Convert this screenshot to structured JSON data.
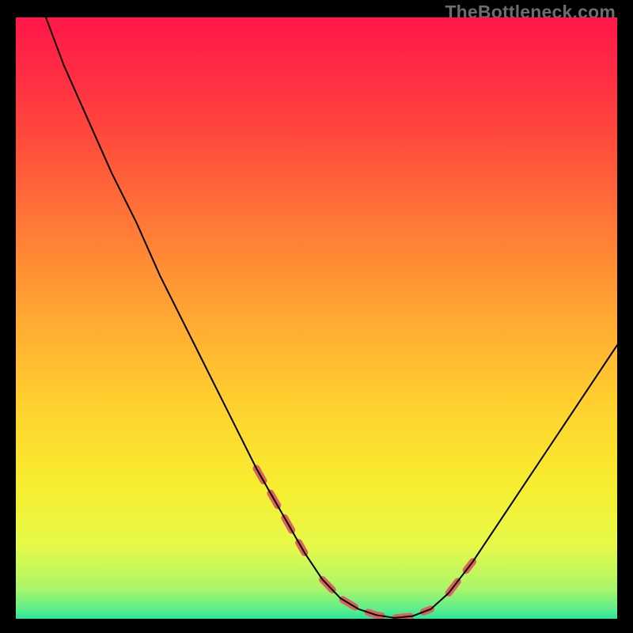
{
  "watermark": "TheBottleneck.com",
  "chart_data": {
    "type": "line",
    "title": "",
    "xlabel": "",
    "ylabel": "",
    "xlim": [
      0,
      100
    ],
    "ylim": [
      0,
      100
    ],
    "background_gradient_stops": [
      {
        "offset": 0.0,
        "color": "#ff1749"
      },
      {
        "offset": 0.08,
        "color": "#ff2945"
      },
      {
        "offset": 0.2,
        "color": "#ff4a3c"
      },
      {
        "offset": 0.35,
        "color": "#ff7a36"
      },
      {
        "offset": 0.5,
        "color": "#ffa932"
      },
      {
        "offset": 0.65,
        "color": "#ffd22e"
      },
      {
        "offset": 0.78,
        "color": "#f7ee2f"
      },
      {
        "offset": 0.88,
        "color": "#e6f94a"
      },
      {
        "offset": 0.95,
        "color": "#a9f668"
      },
      {
        "offset": 0.985,
        "color": "#5bee8c"
      },
      {
        "offset": 1.0,
        "color": "#27e79b"
      }
    ],
    "series": [
      {
        "name": "curve",
        "x": [
          5,
          8,
          12,
          16,
          20,
          24,
          28,
          32,
          36,
          40,
          44,
          48,
          51,
          54,
          57,
          60,
          63,
          66,
          69,
          72,
          76,
          80,
          84,
          88,
          92,
          96,
          100
        ],
        "y": [
          100,
          92,
          83,
          74,
          66,
          57,
          49,
          41,
          33,
          25,
          18,
          11,
          6.5,
          3.4,
          1.6,
          0.6,
          0.15,
          0.45,
          1.6,
          4.3,
          9.5,
          15.5,
          21.5,
          27.5,
          33.5,
          39.5,
          45.5
        ],
        "stroke": "#000000",
        "stroke_width": 2
      },
      {
        "name": "highlight-left",
        "x": [
          40,
          44,
          48
        ],
        "y": [
          25,
          18,
          11
        ],
        "stroke": "#db625d",
        "stroke_width": 9,
        "dash": true
      },
      {
        "name": "highlight-bottom",
        "x": [
          51,
          54,
          57,
          60,
          63,
          66,
          69
        ],
        "y": [
          6.5,
          3.4,
          1.6,
          0.6,
          0.15,
          0.45,
          1.6
        ],
        "stroke": "#db625d",
        "stroke_width": 9,
        "dash": true
      },
      {
        "name": "highlight-right",
        "x": [
          72,
          76
        ],
        "y": [
          4.3,
          9.5
        ],
        "stroke": "#db625d",
        "stroke_width": 9,
        "dash": true
      }
    ]
  }
}
